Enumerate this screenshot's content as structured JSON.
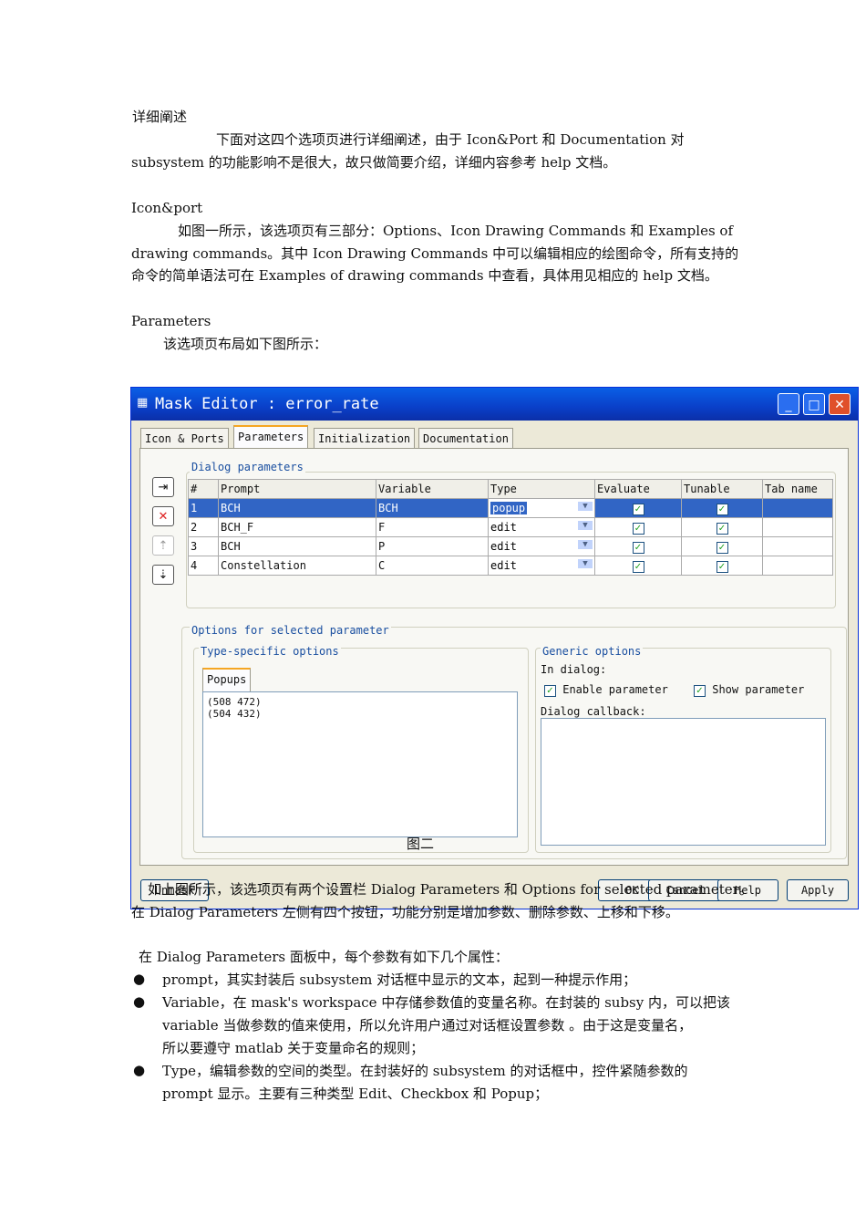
{
  "doc": {
    "heading1": "详细阐述",
    "p1_l1": "下面对这四个选项页进行详细阐述，由于 Icon&Port 和 Documentation 对",
    "p1_l2": "subsystem 的功能影响不是很大，故只做简要介绍，详细内容参考 help 文档。",
    "heading2": "Icon&port",
    "p2_l1": "如图一所示，该选项页有三部分：Options、Icon Drawing Commands 和 Examples of",
    "p2_l2": "drawing commands。其中 Icon Drawing Commands 中可以编辑相应的绘图命令，所有支持的",
    "p2_l3": "命令的简单语法可在 Examples of drawing commands 中查看，具体用见相应的 help 文档。",
    "heading3": "Parameters",
    "p3": "该选项页布局如下图所示：",
    "caption": "图二",
    "p4_l1": "如上图所示，该选项页有两个设置栏 Dialog Parameters 和 Options for selected parameter。",
    "p4_l2": "在 Dialog Parameters 左侧有四个按钮，功能分别是增加参数、删除参数、上移和下移。",
    "p5": "在 Dialog Parameters 面板中，每个参数有如下几个属性：",
    "b1": "prompt，其实封装后 subsystem 对话框中显示的文本，起到一种提示作用；",
    "b2_l1": "Variable，在 mask's workspace 中存储参数值的变量名称。在封装的 subsy 内，可以把该",
    "b2_l2": "variable 当做参数的值来使用，所以允许用户通过对话框设置参数 。由于这是变量名，",
    "b2_l3": "所以要遵守 matlab 关于变量命名的规则；",
    "b3_l1": "Type，编辑参数的空间的类型。在封装好的 subsystem 的对话框中，控件紧随参数的",
    "b3_l2": "prompt 显示。主要有三种类型 Edit、Checkbox 和 Popup；"
  },
  "dialog": {
    "title": "Mask Editor : error_rate",
    "tabs": [
      "Icon & Ports",
      "Parameters",
      "Initialization",
      "Documentation"
    ],
    "dialog_params_label": "Dialog parameters",
    "columns": [
      "#",
      "Prompt",
      "Variable",
      "Type",
      "Evaluate",
      "Tunable",
      "Tab name"
    ],
    "rows": [
      {
        "n": "1",
        "prompt": "BCH",
        "variable": "BCH",
        "type": "popup",
        "evaluate": true,
        "tunable": true,
        "tab": ""
      },
      {
        "n": "2",
        "prompt": "BCH_F",
        "variable": "F",
        "type": "edit",
        "evaluate": true,
        "tunable": true,
        "tab": ""
      },
      {
        "n": "3",
        "prompt": "BCH",
        "variable": "P",
        "type": "edit",
        "evaluate": true,
        "tunable": true,
        "tab": ""
      },
      {
        "n": "4",
        "prompt": "Constellation",
        "variable": "C",
        "type": "edit",
        "evaluate": true,
        "tunable": true,
        "tab": ""
      }
    ],
    "options_label": "Options for selected parameter",
    "type_specific_label": "Type-specific options",
    "popups_tab": "Popups",
    "popup_lines": [
      "(508 472)",
      "(504 432)"
    ],
    "generic_label": "Generic options",
    "in_dialog": "In dialog:",
    "enable_param": "Enable parameter",
    "show_param": "Show parameter",
    "callback_label": "Dialog callback:",
    "buttons": [
      "Unmask",
      "OK",
      "Cancel",
      "Help",
      "Apply"
    ]
  },
  "colors": {
    "titlebar": "#0a4fd8",
    "selected_row": "#3165c5",
    "dialog_bg": "#ece9d8"
  }
}
